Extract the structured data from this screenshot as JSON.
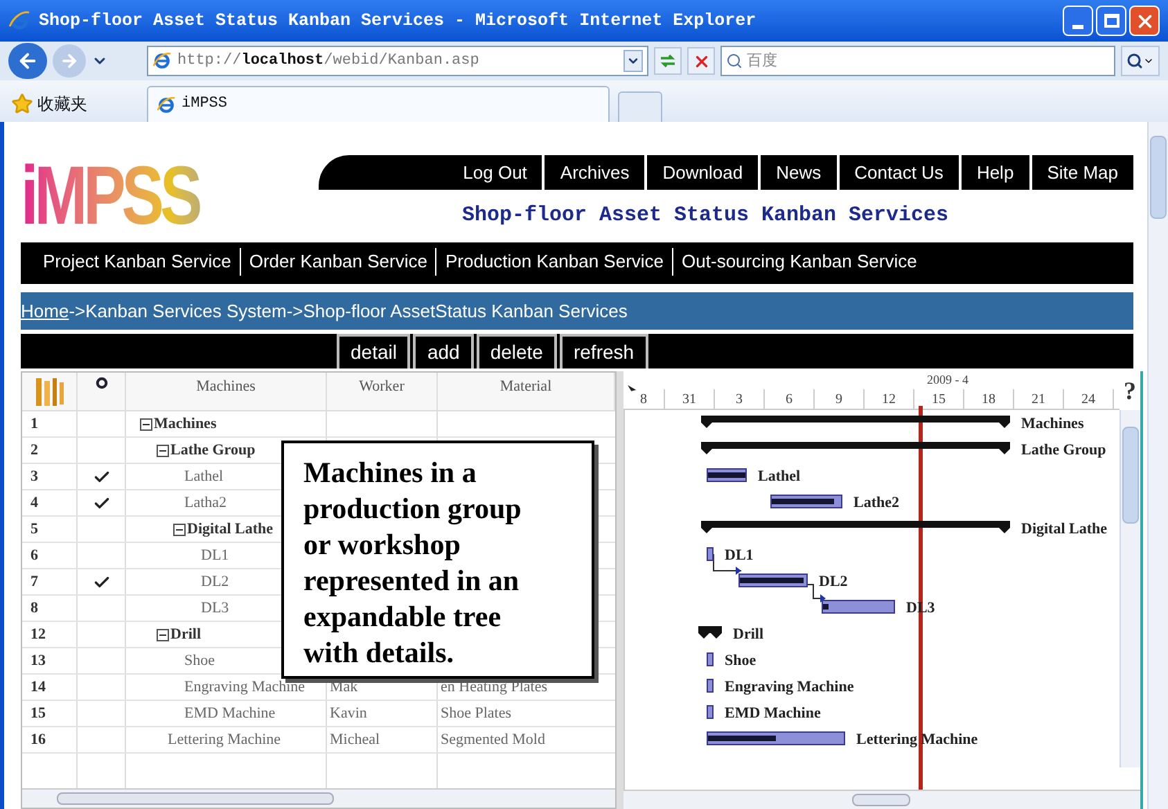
{
  "window": {
    "title": "Shop-floor Asset Status Kanban Services - Microsoft Internet Explorer"
  },
  "address_bar": {
    "url": "http://**localhost**/webid/Kanban.asp"
  },
  "search": {
    "placeholder": "百度"
  },
  "favorites": {
    "label": "收藏夹"
  },
  "tabs": [
    {
      "label": "iMPSS",
      "selected": true
    }
  ],
  "logo": "iMPSS",
  "top_nav": [
    "Log Out",
    "Archives",
    "Download",
    "News",
    "Contact Us",
    "Help",
    "Site Map"
  ],
  "site_title": "Shop-floor Asset Status Kanban Services",
  "services": [
    "Project Kanban Service",
    "Order Kanban Service",
    "Production Kanban Service",
    "Out-sourcing Kanban Service"
  ],
  "breadcrumb": {
    "link": "Home",
    "trail": "->Kanban Services System->Shop-floor AssetStatus Kanban Services"
  },
  "toolbar": [
    "detail",
    "add",
    "delete",
    "refresh"
  ],
  "table": {
    "columns": [
      "Machines",
      "Worker",
      "Material"
    ],
    "rows": [
      {
        "number": "1",
        "checked": false,
        "name": "Machines",
        "expanded": true,
        "children": [
          {
            "number": "2",
            "checked": false,
            "name": "Lathe Group",
            "expanded": true,
            "children": [
              {
                "number": "3",
                "checked": true,
                "name": "Lathel"
              },
              {
                "number": "4",
                "checked": true,
                "name": "Latha2"
              },
              {
                "number": "5",
                "checked": false,
                "name": "Digital Lathe",
                "expanded": true,
                "children": [
                  {
                    "number": "6",
                    "checked": false,
                    "name": "DL1"
                  },
                  {
                    "number": "7",
                    "checked": true,
                    "name": "DL2"
                  },
                  {
                    "number": "8",
                    "checked": false,
                    "name": "DL3"
                  }
                ]
              }
            ]
          },
          {
            "number": "12",
            "checked": false,
            "name": "Drill",
            "expanded": true,
            "children": [
              {
                "number": "13",
                "checked": false,
                "name": "Shoe"
              },
              {
                "number": "14",
                "checked": false,
                "name": "Engraving Machine",
                "worker": "Mak",
                "material": "en Heating Plates"
              },
              {
                "number": "15",
                "checked": false,
                "name": "EMD Machine",
                "worker": "Kavin",
                "material": "Shoe Plates"
              }
            ]
          },
          {
            "number": "16",
            "checked": false,
            "name": "Lettering Machine",
            "worker": "Micheal",
            "material": "Segmented Mold"
          }
        ]
      }
    ]
  },
  "gantt": {
    "month": "2009 - 4",
    "days": [
      "8",
      "31",
      "3",
      "6",
      "9",
      "12",
      "15",
      "18",
      "21",
      "24"
    ],
    "help": "?",
    "tasks": [
      {
        "label": "Machines",
        "kind": "summary"
      },
      {
        "label": "Lathe Group",
        "kind": "summary"
      },
      {
        "label": "Lathel",
        "kind": "task",
        "level": 1
      },
      {
        "label": "Lathe2",
        "kind": "task",
        "level": 0.9
      },
      {
        "label": "Digital Lathe",
        "kind": "summary"
      },
      {
        "label": "DL1",
        "kind": "task"
      },
      {
        "label": "DL2",
        "kind": "task",
        "level": 0.95
      },
      {
        "label": "DL3",
        "kind": "task",
        "level": 0.08
      },
      {
        "label": "Drill",
        "kind": "summary"
      },
      {
        "label": "Shoe",
        "kind": "task"
      },
      {
        "label": "Engraving Machine",
        "kind": "task"
      },
      {
        "label": "EMD Machine",
        "kind": "task"
      },
      {
        "label": "Lettering Machine",
        "kind": "task",
        "level": 0.5
      }
    ]
  },
  "callout": "Machines in a production group or workshop represented in an expandable tree with details."
}
